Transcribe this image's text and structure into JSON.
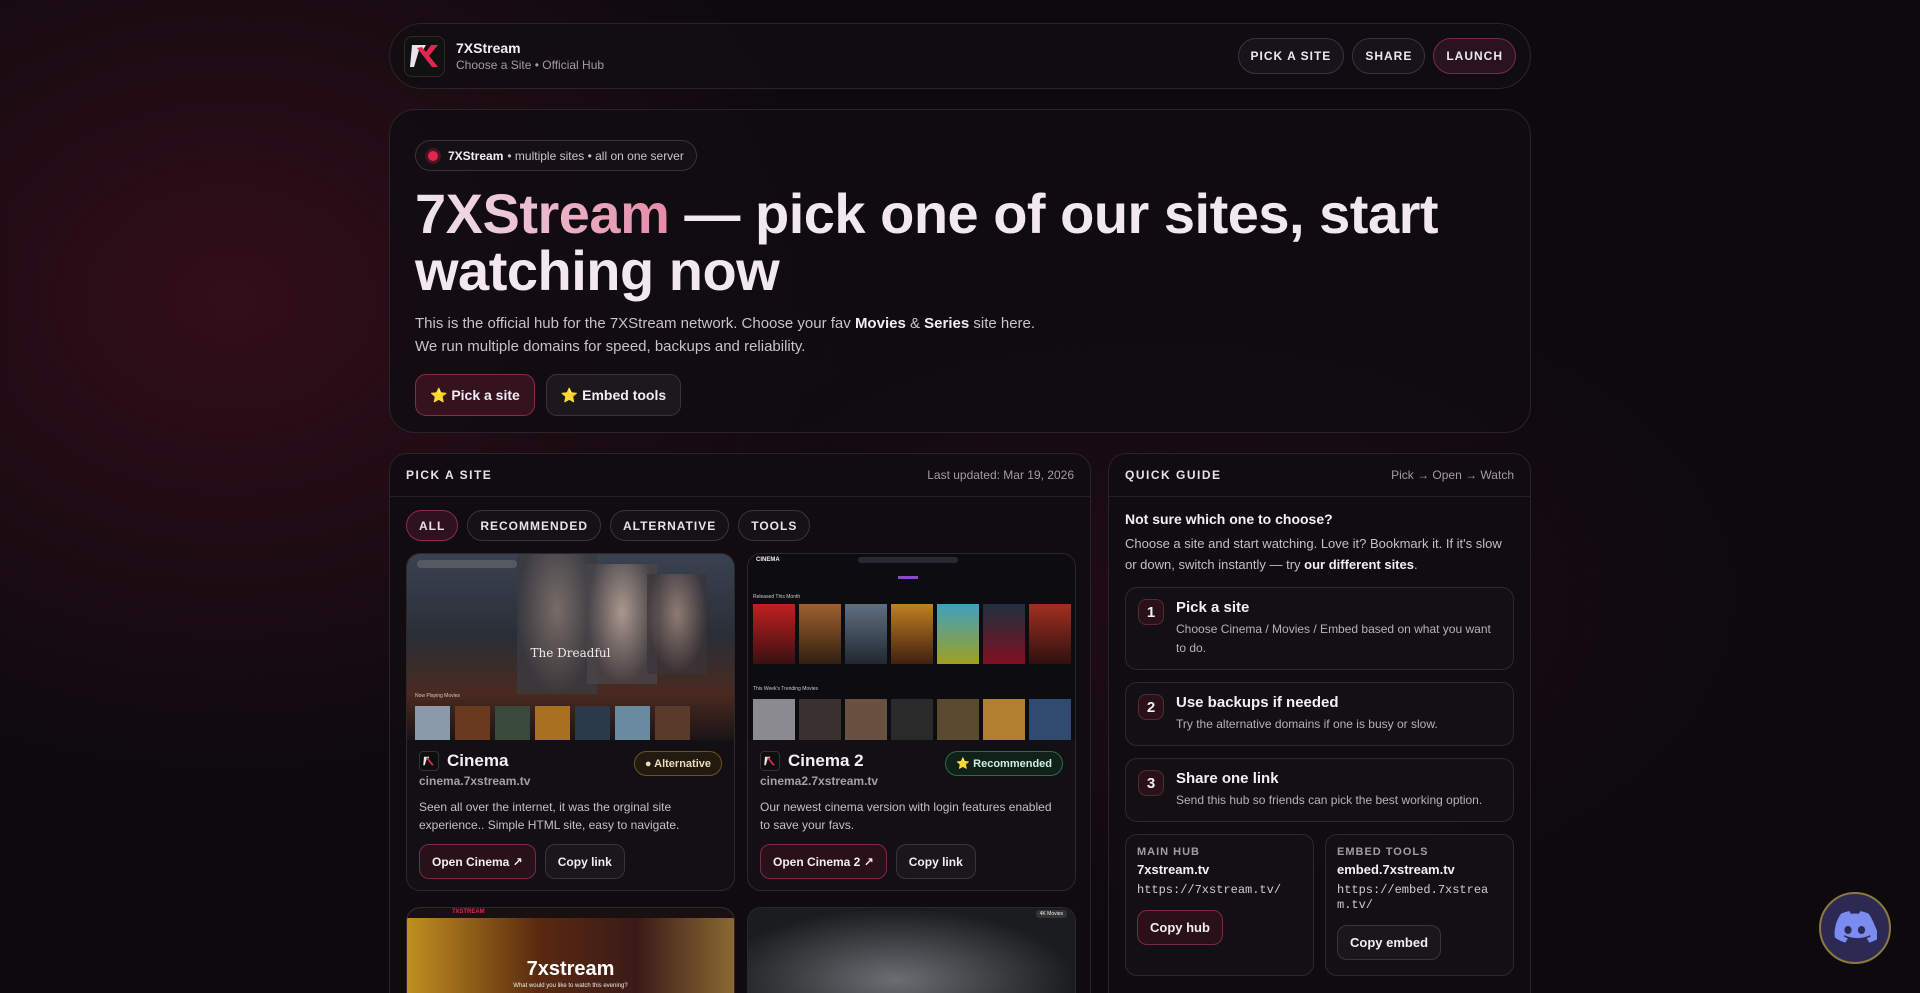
{
  "nav": {
    "brand_title": "7XStream",
    "brand_subtitle": "Choose a Site • Official Hub",
    "buttons": [
      "PICK A SITE",
      "SHARE",
      "LAUNCH"
    ]
  },
  "hero": {
    "chip_brand": "7XStream",
    "chip_text": "• multiple sites • all on one server",
    "title_part1": "7XStream",
    "title_part2": " — pick one of our sites, start watching now",
    "lede_1": "This is the official hub for the 7XStream network. Choose your fav ",
    "lede_movies": "Movies",
    "lede_amp": " & ",
    "lede_series": "Series",
    "lede_1_end": " site here.",
    "lede_2": "We run multiple domains for speed, backups and reliability.",
    "btn_pick": "⭐ Pick a site",
    "btn_embed": "⭐ Embed tools"
  },
  "pick": {
    "title": "PICK A SITE",
    "updated": "Last updated: Mar 19, 2026",
    "filters": [
      "ALL",
      "RECOMMENDED",
      "ALTERNATIVE",
      "TOOLS"
    ],
    "cards": [
      {
        "name": "Cinema",
        "url": "cinema.7xstream.tv",
        "badge": "● Alternative",
        "desc": "Seen all over the internet, it was the orginal site experience.. Simple HTML site, easy to navigate.",
        "open": "Open Cinema ↗",
        "copy": "Copy link",
        "shot_title": "The Dreadful",
        "shot_row": "Now Playing Movies"
      },
      {
        "name": "Cinema 2",
        "url": "cinema2.7xstream.tv",
        "badge": "⭐ Recommended",
        "desc": "Our newest cinema version with login features enabled to save your favs.",
        "open": "Open Cinema 2 ↗",
        "copy": "Copy link",
        "shot_brand": "CINEMA",
        "shot_row1": "Released This Month",
        "shot_row2": "This Week's Trending Movies"
      },
      {
        "shot_brand": "7XSTREAM",
        "shot_title": "7xstream",
        "shot_sub": "What would you like to watch this evening?"
      },
      {
        "shot_badge": "4K Movies"
      }
    ]
  },
  "guide": {
    "title": "QUICK GUIDE",
    "meta": "Pick → Open → Watch",
    "question": "Not sure which one to choose?",
    "text": "Choose a site and start watching. Love it? Bookmark it. If it's slow or down, switch instantly — try ",
    "text_bold": "our different sites",
    "text_end": ".",
    "steps": [
      {
        "num": "1",
        "title": "Pick a site",
        "desc": "Choose Cinema / Movies / Embed based on what you want to do."
      },
      {
        "num": "2",
        "title": "Use backups if needed",
        "desc": "Try the alternative domains if one is busy or slow."
      },
      {
        "num": "3",
        "title": "Share one link",
        "desc": "Send this hub so friends can pick the best working option."
      }
    ],
    "main_hub": {
      "label": "MAIN HUB",
      "title": "7xstream.tv",
      "url": "https://7xstream.tv/",
      "button": "Copy hub"
    },
    "embed": {
      "label": "EMBED TOOLS",
      "title": "embed.7xstream.tv",
      "url": "https://embed.7xstream.tv/",
      "button": "Copy embed"
    }
  },
  "colors": {
    "accent": "#e0284f",
    "bg": "#0c0a0d"
  },
  "icons": {
    "logo": "7x-logo-icon",
    "discord": "discord-icon"
  }
}
